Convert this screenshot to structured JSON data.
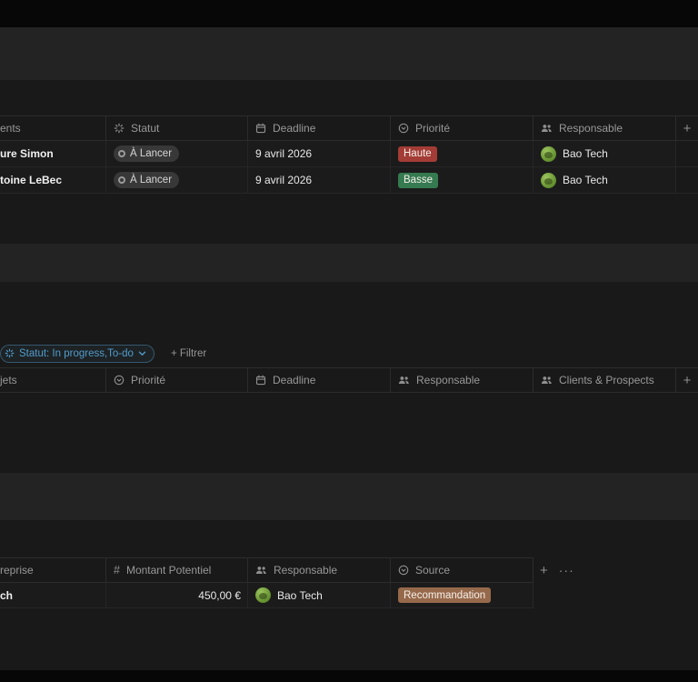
{
  "colors": {
    "background": "#191919",
    "band": "#232323",
    "accent_blue": "#529cca",
    "badge_red": "#a33c36",
    "badge_green": "#357a50",
    "badge_brown": "#96694b",
    "status_pill_gray": "#383838",
    "avatar_green": "#628f2e"
  },
  "icons": {
    "number_glyph": "#",
    "plus_glyph": "+",
    "ellipsis_glyph": "···"
  },
  "clients_table": {
    "columns": [
      {
        "label": "ents",
        "icon": ""
      },
      {
        "label": "Statut",
        "icon": "status-icon"
      },
      {
        "label": "Deadline",
        "icon": "calendar-icon"
      },
      {
        "label": "Priorité",
        "icon": "select-icon"
      },
      {
        "label": "Responsable",
        "icon": "people-icon"
      }
    ],
    "add_column": "+",
    "rows": [
      {
        "name": "ure Simon",
        "statut": "À Lancer",
        "deadline": "9 avril 2026",
        "priorite": "Haute",
        "priorite_color": "#a33c36",
        "responsable": "Bao Tech"
      },
      {
        "name": "toine LeBec",
        "statut": "À Lancer",
        "deadline": "9 avril 2026",
        "priorite": "Basse",
        "priorite_color": "#357a50",
        "responsable": "Bao Tech"
      }
    ]
  },
  "filter_bar": {
    "chip_label": "Statut: In progress,To-do",
    "add_filter": "+ Filtrer"
  },
  "projects_table": {
    "columns": [
      {
        "label": "jets",
        "icon": ""
      },
      {
        "label": "Priorité",
        "icon": "select-icon"
      },
      {
        "label": "Deadline",
        "icon": "calendar-icon"
      },
      {
        "label": "Responsable",
        "icon": "people-icon"
      },
      {
        "label": "Clients & Prospects",
        "icon": "people-icon"
      }
    ],
    "add_column": "+"
  },
  "prospects_table": {
    "columns": [
      {
        "label": "reprise",
        "icon": ""
      },
      {
        "label": "Montant Potentiel",
        "icon": "number-icon"
      },
      {
        "label": "Responsable",
        "icon": "people-icon"
      },
      {
        "label": "Source",
        "icon": "select-icon"
      }
    ],
    "add_column": "+",
    "more_options": "···",
    "rows": [
      {
        "name": "ch",
        "montant": "450,00 €",
        "responsable": "Bao Tech",
        "source": "Recommandation",
        "source_color": "#96694b"
      }
    ]
  }
}
